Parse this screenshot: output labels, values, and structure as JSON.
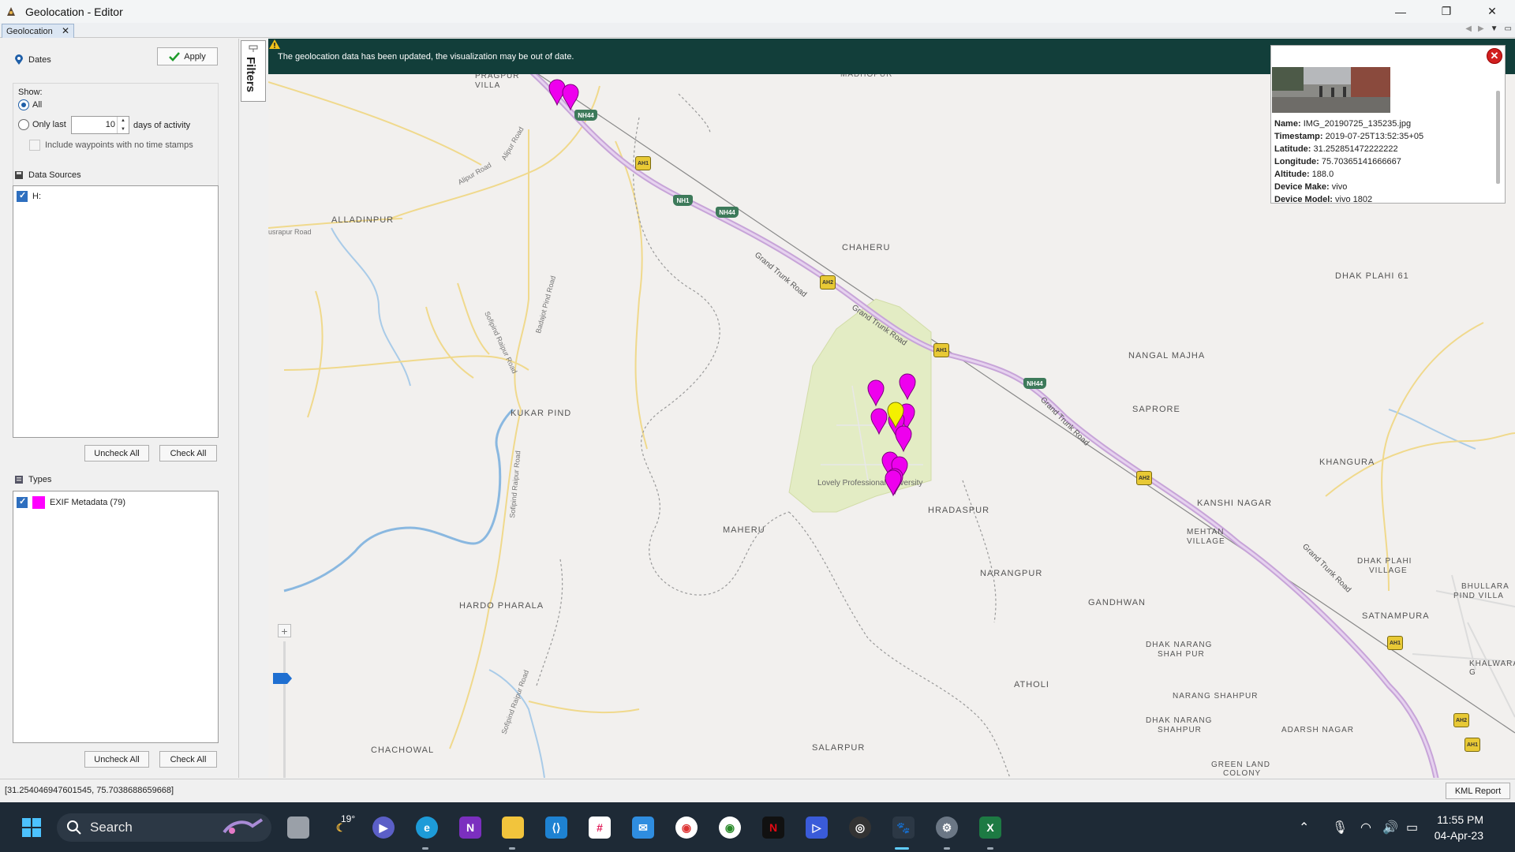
{
  "window": {
    "title": "Geolocation - Editor",
    "controls": [
      "—",
      "❐",
      "✕"
    ]
  },
  "tab": {
    "label": "Geolocation",
    "close": "✕"
  },
  "filters": {
    "apply_label": "Apply",
    "tab_label": "Filters",
    "dates": {
      "header": "Dates",
      "show_label": "Show:",
      "all_label": "All",
      "only_last_label": "Only last",
      "days_value": "10",
      "days_suffix": "days of activity",
      "include_waypoints_label": "Include waypoints with no time stamps"
    },
    "data_sources": {
      "header": "Data Sources",
      "items": [
        {
          "label": "H:",
          "checked": true
        }
      ],
      "uncheck_all": "Uncheck All",
      "check_all": "Check All"
    },
    "types": {
      "header": "Types",
      "items": [
        {
          "label": "EXIF Metadata (79)",
          "checked": true,
          "color": "#ff00ff"
        }
      ],
      "uncheck_all": "Uncheck All",
      "check_all": "Check All"
    }
  },
  "map": {
    "banner": "The geolocation data has been updated, the visualization may be out of date.",
    "zoom_in": "+",
    "zoom_out": "−",
    "places": {
      "pragpur": "PRAGPUR",
      "villa": "VILLA",
      "madhopur": "MADHOPUR",
      "alladinpur": "ALLADINPUR",
      "chaheru": "CHAHERU",
      "dhak_plahi_61": "DHAK PLAHI 61",
      "nangal_majha": "NANGAL MAJHA",
      "saprore": "SAPRORE",
      "kukar_pind": "KUKAR PIND",
      "khangura": "KHANGURA",
      "lpu": "Lovely Professional University",
      "hradaspur": "HRADASPUR",
      "kanshi_nagar": "KANSHI NAGAR",
      "maheru": "MAHERU",
      "mehtan_village_1": "MEHTAN",
      "mehtan_village_2": "VILLAGE",
      "dhak_plahi_village_1": "DHAK PLAHI",
      "dhak_plahi_village_2": "VILLAGE",
      "bhullara_1": "BHULLARA",
      "bhullara_2": "PIND VILLA",
      "narangpur": "NARANGPUR",
      "hardo_pharala": "HARDO PHARALA",
      "gandhwan": "GANDHWAN",
      "satnampura": "SATNAMPURA",
      "dhak_narang_shah_pur_1": "DHAK NARANG",
      "dhak_narang_shah_pur_2": "SHAH PUR",
      "khalwara": "KHALWARA G",
      "atholi": "ATHOLI",
      "narang_shahpur": "NARANG SHAHPUR",
      "dhak_narang_shahpur_1": "DHAK NARANG",
      "dhak_narang_shahpur_2": "SHAHPUR",
      "adarsh_nagar": "ADARSH NAGAR",
      "chachowal": "CHACHOWAL",
      "salarpur": "SALARPUR",
      "green_land_1": "GREEN LAND",
      "green_land_2": "COLONY"
    },
    "roads": {
      "gt1": "Grand Trunk Road",
      "gt2": "Grand Trunk Road",
      "gt3": "Grand Trunk Road",
      "gt4": "Grand Trunk Road",
      "alipur": "Alipur Road",
      "alipur2": "Alipur Road",
      "rajpur": "usrapur Road",
      "badajot": "Badajot Pind Road",
      "sofipind": "Sofipind Raipur Road",
      "sofipind2": "Sofipind Raipur Road",
      "sofipind3": "Sofipind Raipur Road"
    },
    "shields": {
      "nh44a": "NH44",
      "nh44b": "NH44",
      "nh44c": "NH44",
      "nh1": "NH1",
      "ah1a": "AH1",
      "ah1b": "AH1",
      "ah2a": "AH2",
      "ah2b": "AH2",
      "ah1c": "AH1",
      "ah2c": "AH2",
      "ah1d": "AH1"
    }
  },
  "popup": {
    "name_label": "Name:",
    "name": "IMG_20190725_135235.jpg",
    "timestamp_label": "Timestamp:",
    "timestamp": "2019-07-25T13:52:35+05",
    "latitude_label": "Latitude:",
    "latitude": "31.252851472222222",
    "longitude_label": "Longitude:",
    "longitude": "75.70365141666667",
    "altitude_label": "Altitude:",
    "altitude": "188.0",
    "make_label": "Device Make:",
    "make": "vivo",
    "model_label": "Device Model:",
    "model": "vivo 1802"
  },
  "status": {
    "coordinates": "[31.254046947601545, 75.7038688659668]",
    "kml_report": "KML Report"
  },
  "taskbar": {
    "search_label": "Search",
    "weather": "19°",
    "time": "11:55 PM",
    "date": "04-Apr-23"
  }
}
